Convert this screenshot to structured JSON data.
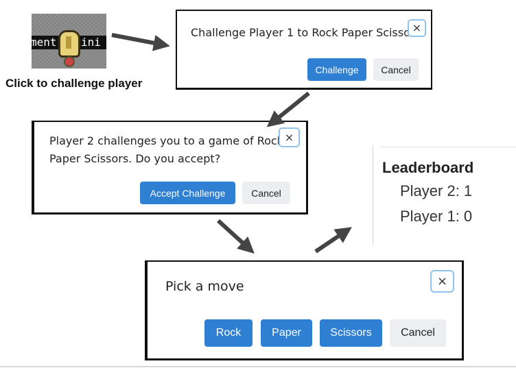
{
  "step_labels": {
    "click_to_challenge": "Click to challenge player"
  },
  "thumbnail": {
    "strip_left_text": "ment",
    "strip_right_text": "ini"
  },
  "challenge_dialog": {
    "message": "Challenge Player 1 to Rock Paper Scissors",
    "confirm_label": "Challenge",
    "cancel_label": "Cancel",
    "close_label": "×"
  },
  "incoming_dialog": {
    "message_line1": "Player 2 challenges you to a game of Rock",
    "message_line2": "Paper Scissors. Do you accept?",
    "accept_label": "Accept Challenge",
    "cancel_label": "Cancel",
    "close_label": "×"
  },
  "move_dialog": {
    "title": "Pick a move",
    "moves": [
      "Rock",
      "Paper",
      "Scissors"
    ],
    "cancel_label": "Cancel",
    "close_label": "×"
  },
  "leaderboard": {
    "title": "Leaderboard",
    "rows": [
      "Player 2: 1",
      "Player 1: 0"
    ]
  },
  "colors": {
    "primary_button": "#2f7fd3",
    "secondary_button": "#eceef1",
    "close_focus_ring": "#8fc3ea",
    "arrow": "#444444"
  }
}
